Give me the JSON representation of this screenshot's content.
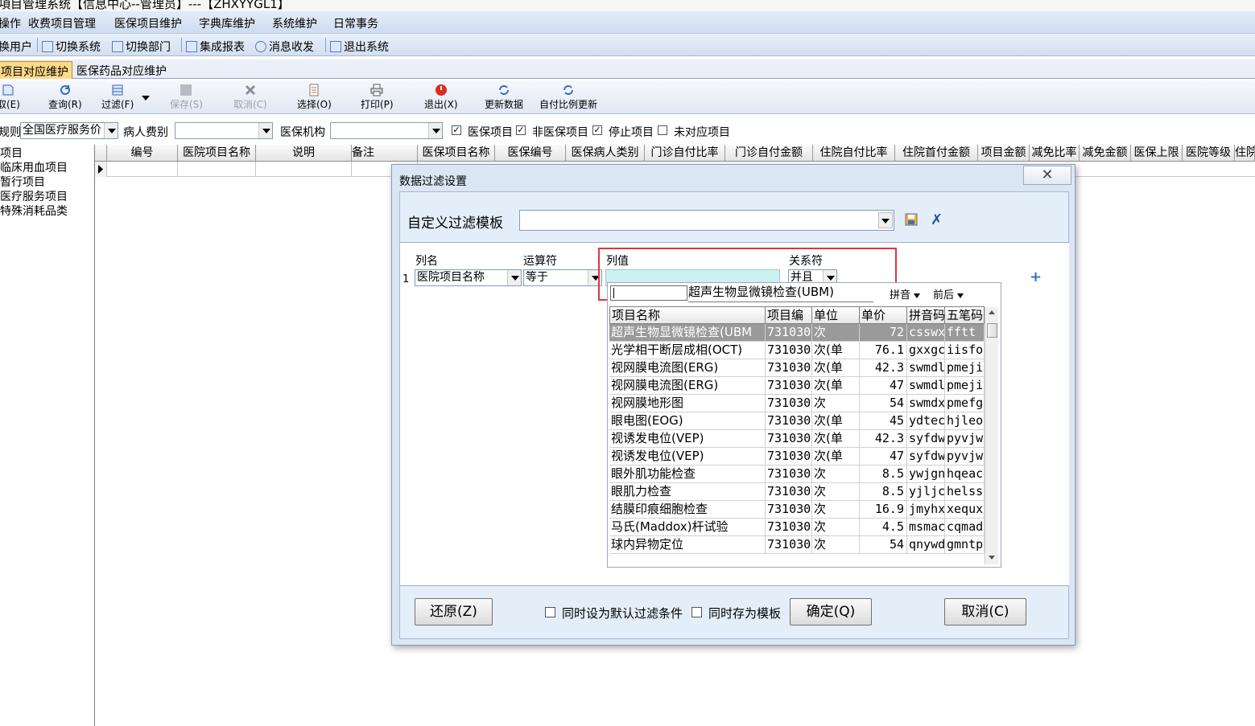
{
  "window": {
    "title": "項目管理系统【信息中心--管理员】---【ZHXYYGL1】"
  },
  "menu": [
    "操作",
    "收费项目管理",
    "医保项目维护",
    "字典库维护",
    "系统维护",
    "日常事务"
  ],
  "quickbar": [
    "换用户",
    "切换系统",
    "切换部门",
    "集成报表",
    "消息收发",
    "退出系统"
  ],
  "tabs": [
    "项目对应维护",
    "医保药品对应维护"
  ],
  "toolbar": {
    "items": [
      "取(E)",
      "查询(R)",
      "过滤(F)",
      "保存(S)",
      "取消(C)",
      "选择(O)",
      "打印(P)",
      "退出(X)",
      "更新数据",
      "自付比例更新"
    ]
  },
  "filters": {
    "rule_label": "规则",
    "rule_value": "全国医疗服务价",
    "patient_fee_label": "病人费别",
    "patient_fee_value": "",
    "insurance_org_label": "医保机构",
    "insurance_org_value": "",
    "chk_insured": "医保项目",
    "chk_non_insured": "非医保项目",
    "chk_stopped": "停止项目",
    "chk_unmatched": "未对应项目"
  },
  "tree": [
    "项目",
    "临床用血项目",
    "暂行项目",
    "医疗服务项目",
    "特殊消耗品类"
  ],
  "grid": {
    "columns": [
      "编号",
      "医院项目名称",
      "说明",
      "备注",
      "医保项目名称",
      "医保编号",
      "医保病人类别",
      "门诊自付比率",
      "门诊自付金额",
      "住院自付比率",
      "住院首付金额",
      "项目金额",
      "减免比率",
      "减免金额",
      "医保上限",
      "医院等级",
      "住院"
    ]
  },
  "dialog": {
    "title": "数据过滤设置",
    "close_glyph": "✕",
    "template_label": "自定义过滤模板",
    "template_value": "",
    "cond_headers": {
      "col": "列名",
      "op": "运算符",
      "val": "列值",
      "rel": "关系符"
    },
    "row_number": "1",
    "row": {
      "col": "医院项目名称",
      "op": "等于",
      "val": "",
      "rel": "并且"
    },
    "popup": {
      "search_value": "",
      "current": "超声生物显微镜检查(UBM)",
      "opt1": "拼音",
      "opt2": "前后",
      "columns": [
        "项目名称",
        "项目编",
        "单位",
        "单价",
        "拼音码",
        "五笔码"
      ],
      "rows": [
        [
          "超声生物显微镜检查(UBM",
          "731030",
          "次",
          "72",
          "csswx",
          "fftt"
        ],
        [
          "光学相干断层成相(OCT)",
          "731030",
          "次(单",
          "76.1",
          "gxxgc",
          "iisfo"
        ],
        [
          "视网膜电流图(ERG)",
          "731030",
          "次(单",
          "42.3",
          "swmdl",
          "pmeji"
        ],
        [
          "视网膜电流图(ERG)",
          "731030",
          "次(单",
          "47",
          "swmdl",
          "pmeji"
        ],
        [
          "视网膜地形图",
          "731030",
          "次",
          "54",
          "swmdx",
          "pmefg"
        ],
        [
          "眼电图(EOG)",
          "731030",
          "次(单",
          "45",
          "ydtec",
          "hjleo"
        ],
        [
          "视诱发电位(VEP)",
          "731030",
          "次(单",
          "42.3",
          "syfdw",
          "pyvjw"
        ],
        [
          "视诱发电位(VEP)",
          "731030",
          "次(单",
          "47",
          "syfdw",
          "pyvjw"
        ],
        [
          "眼外肌功能检查",
          "731030",
          "次",
          "8.5",
          "ywjgn",
          "hqeac"
        ],
        [
          "眼肌力检查",
          "731030",
          "次",
          "8.5",
          "yjljc",
          "helss"
        ],
        [
          "结膜印痕细胞检查",
          "731030",
          "次",
          "16.9",
          "jmyhx",
          "xequx"
        ],
        [
          "马氏(Maddox)杆试验",
          "731030",
          "次",
          "4.5",
          "msmac",
          "cqmad"
        ],
        [
          "球内异物定位",
          "731030",
          "次",
          "54",
          "qnywd",
          "gmntp"
        ]
      ]
    },
    "buttons": {
      "reset": "还原(Z)",
      "ok": "确定(Q)",
      "cancel": "取消(C)"
    },
    "check_default": "同时设为默认过滤条件",
    "check_template": "同时存为模板"
  }
}
